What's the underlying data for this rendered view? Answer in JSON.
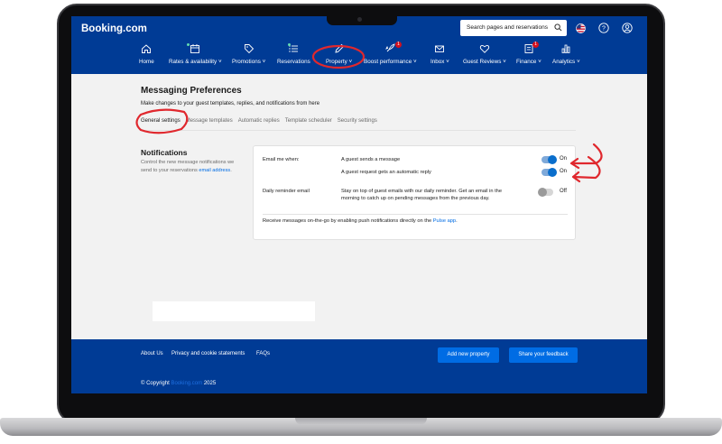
{
  "header": {
    "logo": "Booking.com",
    "search_placeholder": "Search pages and reservations"
  },
  "nav": [
    {
      "label": "Home",
      "icon": "home-icon"
    },
    {
      "label": "Rates & availability",
      "icon": "calendar-icon",
      "dot": true
    },
    {
      "label": "Promotions",
      "icon": "tag-icon"
    },
    {
      "label": "Reservations",
      "icon": "list-icon",
      "dot": true
    },
    {
      "label": "Property",
      "icon": "pencil-icon"
    },
    {
      "label": "Boost performance",
      "icon": "rocket-icon",
      "badge": "1"
    },
    {
      "label": "Inbox",
      "icon": "envelope-icon"
    },
    {
      "label": "Guest Reviews",
      "icon": "heart-icon"
    },
    {
      "label": "Finance",
      "icon": "document-icon",
      "badge": "1"
    },
    {
      "label": "Analytics",
      "icon": "bar-chart-icon"
    }
  ],
  "page": {
    "title": "Messaging Preferences",
    "subtitle": "Make changes to your guest templates, replies, and notifications from here",
    "tabs": [
      "General settings",
      "Message templates",
      "Automatic replies",
      "Template scheduler",
      "Security settings"
    ]
  },
  "notifications": {
    "title": "Notifications",
    "desc": "Control the new message notifications we send to your reservations",
    "desc_link": "email address",
    "desc_end": ".",
    "email_label": "Email me when:",
    "option1": "A guest sends a message",
    "option1_state": "On",
    "option2": "A guest request gets an automatic reply",
    "option2_state": "On",
    "daily_label": "Daily reminder email",
    "daily_desc": "Stay on top of guest emails with our daily reminder. Get an email in the morning to catch up on pending messages from the previous day.",
    "daily_state": "Off",
    "pulse_text": "Receive messages on-the-go by enabling push notifications directly on the",
    "pulse_link": "Pulse app",
    "pulse_end": "."
  },
  "footer": {
    "links": [
      "About Us",
      "Privacy and cookie statements",
      "FAQs"
    ],
    "add_property": "Add new property",
    "feedback": "Share your feedback",
    "copyright": "© Copyright",
    "brand": "Booking.com",
    "year": "2025"
  },
  "colors": {
    "brand_blue": "#003b95",
    "action_blue": "#006ce4",
    "toggle_on": "#0a6ecc",
    "annotation_red": "#e0282e"
  }
}
